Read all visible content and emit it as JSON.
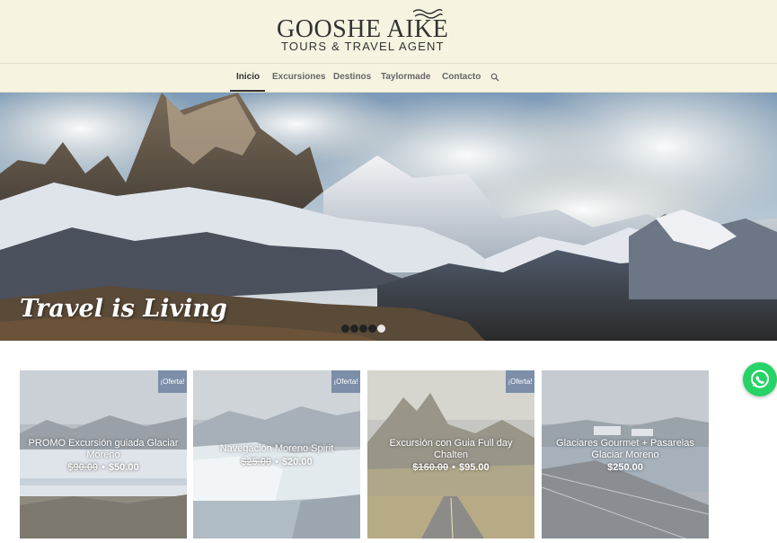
{
  "logo": {
    "title": "GOOSHE AIKE",
    "subtitle": "TOURS & TRAVEL AGENT",
    "icon": "waves-icon"
  },
  "nav": {
    "items": [
      {
        "label": "Inicio",
        "active": true
      },
      {
        "label": "Excursiones",
        "active": false
      },
      {
        "label": "Destinos",
        "active": false
      },
      {
        "label": "Taylormade",
        "active": false
      },
      {
        "label": "Contacto",
        "active": false
      }
    ],
    "search_icon": "search-icon"
  },
  "hero": {
    "tagline": "Travel is Living",
    "slides_total": 5,
    "active_slide": 5
  },
  "cards": [
    {
      "title": "PROMO Excursión guiada Glaciar Moreno",
      "old_price": "$90.00",
      "price": "$50.00",
      "badge": "¡Oferta!"
    },
    {
      "title": "Navegación Moreno Spirit",
      "old_price": "$25.00",
      "price": "$20.00",
      "badge": "¡Oferta!"
    },
    {
      "title": "Excursión con Guia Full day Chalten",
      "old_price": "$160.00",
      "price": "$95.00",
      "badge": "¡Oferta!"
    },
    {
      "title": "Glaciares Gourmet + Pasarelas Glaciar Moreno",
      "old_price": "",
      "price": "$250.00",
      "badge": ""
    }
  ],
  "whatsapp": {
    "icon": "whatsapp-icon"
  },
  "colors": {
    "header_bg": "#f6f4e1",
    "badge_bg": "#7c8ea8",
    "whatsapp_green": "#25d366"
  }
}
